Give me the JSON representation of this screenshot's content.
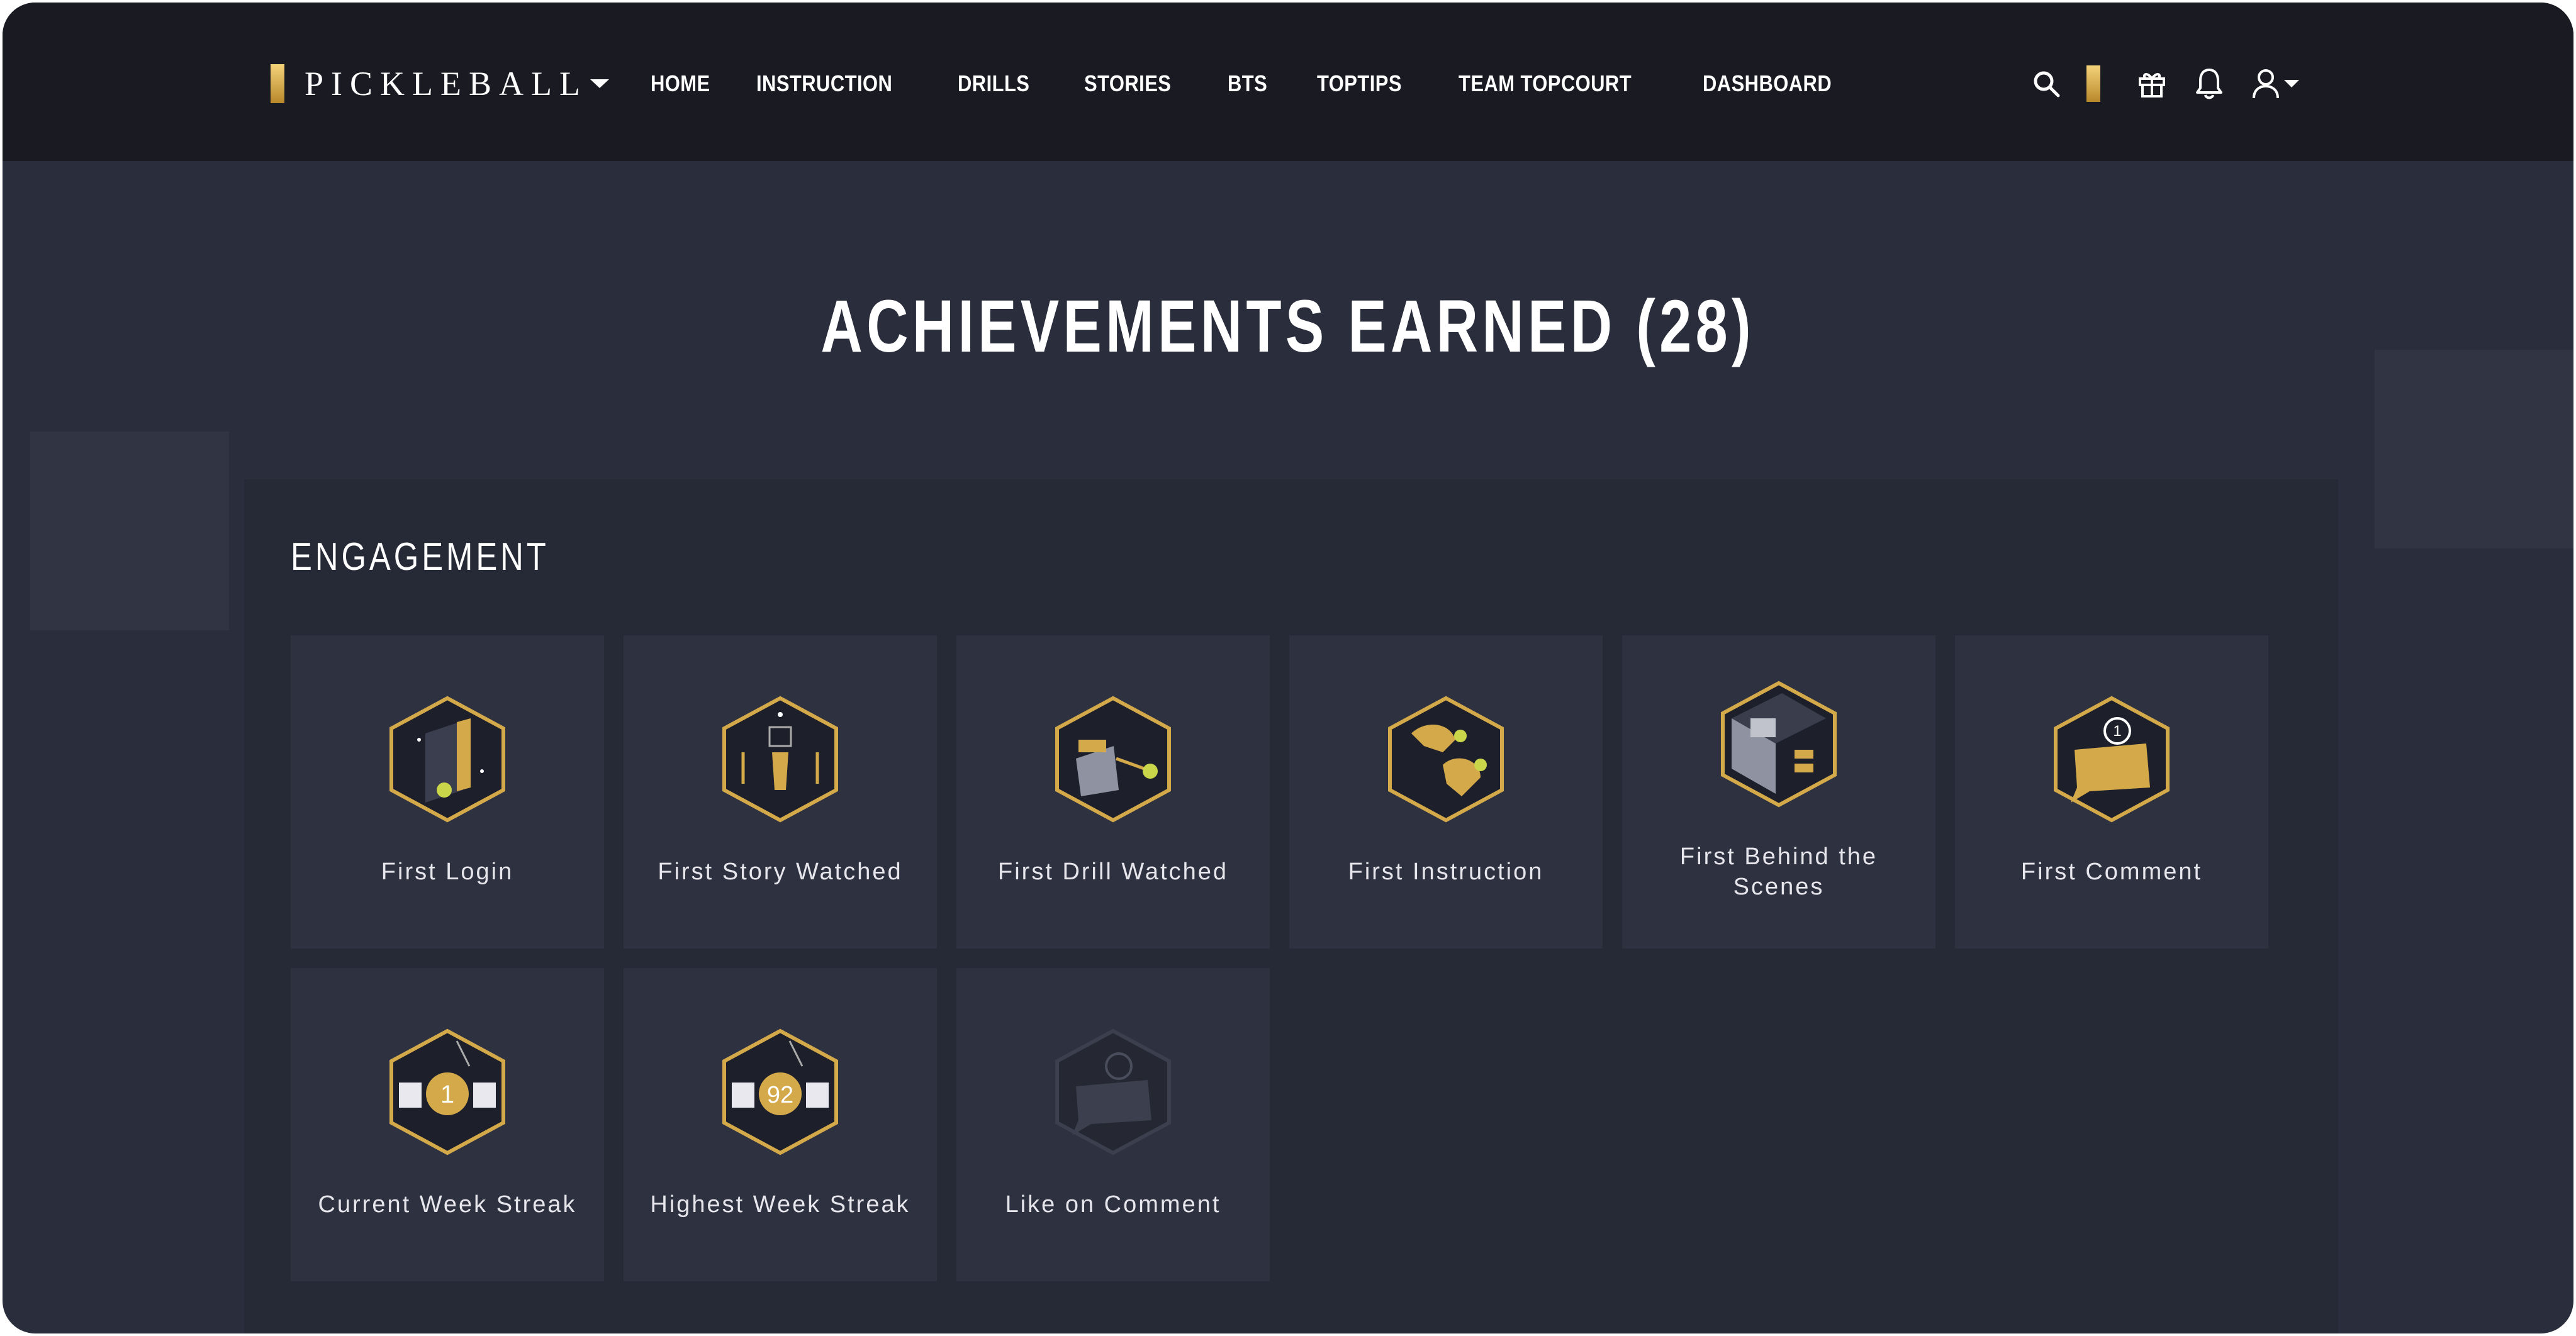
{
  "nav": {
    "logo_text": "PICKLEBALL",
    "menu": [
      "HOME",
      "INSTRUCTION",
      "DRILLS",
      "STORIES",
      "BTS",
      "TOPTIPS",
      "TEAM TOPCOURT",
      "DASHBOARD"
    ],
    "icons": [
      "search-icon",
      "coin-icon",
      "gift-icon",
      "bell-icon",
      "user-icon",
      "chevron-down-icon"
    ]
  },
  "page": {
    "title": "ACHIEVEMENTS EARNED (28)"
  },
  "section": {
    "title": "ENGAGEMENT",
    "achievements": [
      {
        "label": "First Login",
        "icon": "door-badge-icon",
        "earned": true
      },
      {
        "label": "First Story Watched",
        "icon": "story-badge-icon",
        "earned": true
      },
      {
        "label": "First Drill Watched",
        "icon": "drill-badge-icon",
        "earned": true
      },
      {
        "label": "First Instruction",
        "icon": "instruction-badge-icon",
        "earned": true
      },
      {
        "label": "First Behind the Scenes",
        "icon": "camera-badge-icon",
        "earned": true
      },
      {
        "label": "First Comment",
        "icon": "comment-badge-icon",
        "earned": true
      },
      {
        "label": "Current Week Streak",
        "icon": "streak-badge-icon",
        "badge_value": "1",
        "earned": true
      },
      {
        "label": "Highest Week Streak",
        "icon": "streak-badge-icon",
        "badge_value": "92",
        "earned": true
      },
      {
        "label": "Like on Comment",
        "icon": "like-badge-icon",
        "earned": false
      }
    ]
  },
  "colors": {
    "gold": "#d4a94a",
    "background": "#2a2d3b",
    "nav": "#191a22",
    "card": "#2e3140"
  }
}
